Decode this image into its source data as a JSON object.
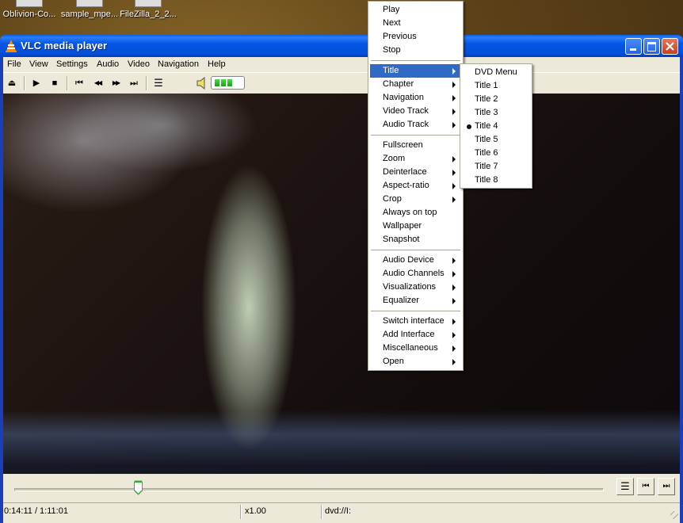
{
  "desktop": {
    "icons": [
      {
        "label": "Oblivion-Co..."
      },
      {
        "label": "sample_mpe..."
      },
      {
        "label": "FileZilla_2_2..."
      }
    ]
  },
  "window": {
    "title": "VLC media player",
    "controls": {
      "minimize": "minimize",
      "maximize": "maximize",
      "close": "close"
    }
  },
  "menubar": [
    "File",
    "View",
    "Settings",
    "Audio",
    "Video",
    "Navigation",
    "Help"
  ],
  "toolbar": {
    "buttons": [
      "eject",
      "play",
      "stop",
      "previous",
      "rewind",
      "fast-forward",
      "next",
      "playlist"
    ],
    "glyphs": {
      "eject": "⏏",
      "play": "▶",
      "stop": "■",
      "previous": "⏮",
      "rewind": "◀◀",
      "fast-forward": "▶▶",
      "next": "⏭",
      "playlist": "☰"
    },
    "volume_level": 0.6
  },
  "seek": {
    "position_fraction": 0.21
  },
  "nav_buttons": {
    "playlist": "☰",
    "previous": "⏮",
    "next": "⏭"
  },
  "status": {
    "time": "0:14:11 / 1:11:01",
    "speed": "x1.00",
    "source": "dvd://I:"
  },
  "context_menu": {
    "groups": [
      [
        {
          "label": "Play"
        },
        {
          "label": "Next"
        },
        {
          "label": "Previous"
        },
        {
          "label": "Stop"
        }
      ],
      [
        {
          "label": "Title",
          "submenu": true,
          "highlighted": true
        },
        {
          "label": "Chapter",
          "submenu": true
        },
        {
          "label": "Navigation",
          "submenu": true
        },
        {
          "label": "Video Track",
          "submenu": true
        },
        {
          "label": "Audio Track",
          "submenu": true
        }
      ],
      [
        {
          "label": "Fullscreen"
        },
        {
          "label": "Zoom",
          "submenu": true
        },
        {
          "label": "Deinterlace",
          "submenu": true
        },
        {
          "label": "Aspect-ratio",
          "submenu": true
        },
        {
          "label": "Crop",
          "submenu": true
        },
        {
          "label": "Always on top"
        },
        {
          "label": "Wallpaper"
        },
        {
          "label": "Snapshot"
        }
      ],
      [
        {
          "label": "Audio Device",
          "submenu": true
        },
        {
          "label": "Audio Channels",
          "submenu": true
        },
        {
          "label": "Visualizations",
          "submenu": true
        },
        {
          "label": "Equalizer",
          "submenu": true
        }
      ],
      [
        {
          "label": "Switch interface",
          "submenu": true
        },
        {
          "label": "Add Interface",
          "submenu": true
        },
        {
          "label": "Miscellaneous",
          "submenu": true
        },
        {
          "label": "Open",
          "submenu": true
        }
      ]
    ]
  },
  "title_submenu": {
    "items": [
      {
        "label": "DVD Menu"
      },
      {
        "label": "Title 1"
      },
      {
        "label": "Title 2"
      },
      {
        "label": "Title 3"
      },
      {
        "label": "Title 4",
        "checked": true
      },
      {
        "label": "Title 5"
      },
      {
        "label": "Title 6"
      },
      {
        "label": "Title 7"
      },
      {
        "label": "Title 8"
      }
    ]
  },
  "colors": {
    "highlight": "#316ac5",
    "titlebar": "#0456e4",
    "face": "#ece9d8",
    "volume": "#2fc12f"
  }
}
